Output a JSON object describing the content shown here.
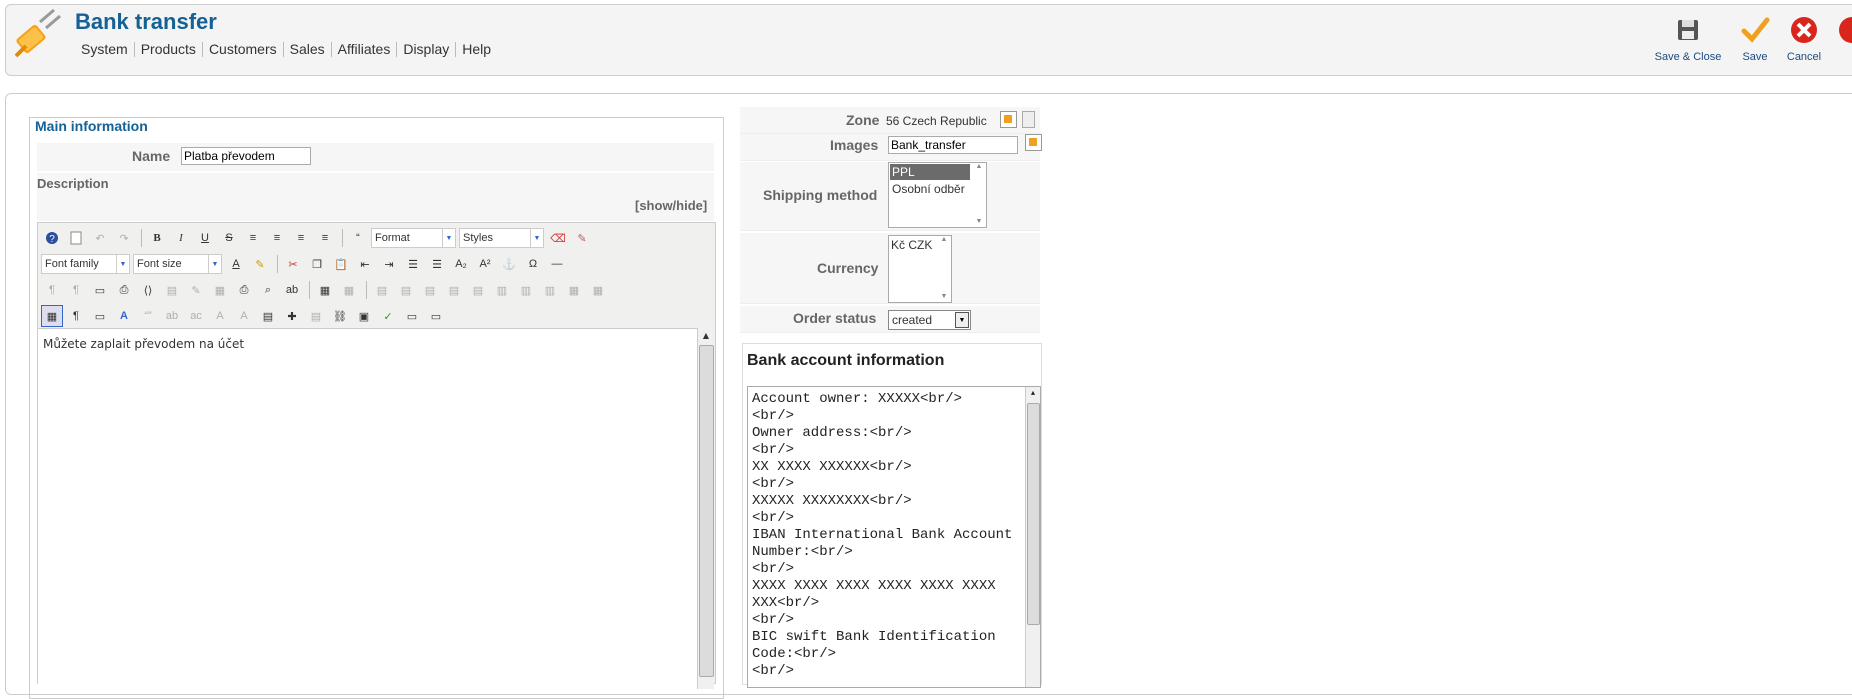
{
  "header": {
    "title": "Bank transfer",
    "menu": [
      "System",
      "Products",
      "Customers",
      "Sales",
      "Affiliates",
      "Display",
      "Help"
    ],
    "toolbar": {
      "save_close": "Save & Close",
      "save": "Save",
      "cancel": "Cancel"
    }
  },
  "main_info": {
    "legend": "Main information",
    "name_label": "Name",
    "name_value": "Platba převodem",
    "description_label": "Description",
    "show_hide": "[show/hide]",
    "editor": {
      "format_label": "Format",
      "styles_label": "Styles",
      "font_family_label": "Font family",
      "font_size_label": "Font size",
      "content": "Můžete zaplait převodem na účet"
    }
  },
  "side_form": {
    "zone_label": "Zone",
    "zone_value": "56 Czech Republic",
    "images_label": "Images",
    "images_value": "Bank_transfer",
    "shipping_label": "Shipping method",
    "shipping_options": [
      "PPL",
      "Osobní odběr"
    ],
    "currency_label": "Currency",
    "currency_options": [
      "Kč CZK"
    ],
    "order_status_label": "Order status",
    "order_status_value": "created"
  },
  "bank_info": {
    "title": "Bank account information",
    "text": "Account owner: XXXXX<br/>\n<br/>\nOwner address:<br/>\n<br/>\nXX XXXX XXXXXX<br/>\n<br/>\nXXXXX XXXXXXXX<br/>\n<br/>\nIBAN International Bank Account Number:<br/>\n<br/>\nXXXX XXXX XXXX XXXX XXXX XXXX XXX<br/>\n<br/>\nBIC swift Bank Identification Code:<br/>\n<br/>"
  },
  "colors": {
    "title_blue": "#146295",
    "selected_option": "#6b6b6b"
  }
}
